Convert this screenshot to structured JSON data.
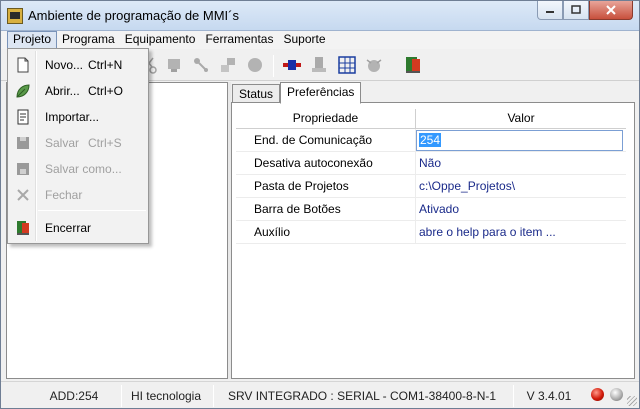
{
  "window": {
    "title": "Ambiente de programação de MMI´s"
  },
  "menubar": {
    "items": [
      "Projeto",
      "Programa",
      "Equipamento",
      "Ferramentas",
      "Suporte"
    ]
  },
  "projeto_menu": {
    "items": [
      {
        "label": "Novo...",
        "shortcut": "Ctrl+N",
        "icon": "new-file-icon",
        "enabled": true
      },
      {
        "label": "Abrir...",
        "shortcut": "Ctrl+O",
        "icon": "open-leaf-icon",
        "enabled": true
      },
      {
        "label": "Importar...",
        "shortcut": "",
        "icon": "import-document-icon",
        "enabled": true
      },
      {
        "label": "Salvar",
        "shortcut": "Ctrl+S",
        "icon": "save-disk-icon",
        "enabled": false
      },
      {
        "label": "Salvar como...",
        "shortcut": "",
        "icon": "save-as-icon",
        "enabled": false
      },
      {
        "label": "Fechar",
        "shortcut": "",
        "icon": "close-x-icon",
        "enabled": false
      },
      {
        "label": "Encerrar",
        "shortcut": "",
        "icon": "exit-door-icon",
        "enabled": true
      }
    ]
  },
  "toolbar": {
    "icons": [
      "cut-icon",
      "component-icon",
      "link-icon",
      "transfer-icon",
      "record-icon",
      "connect-icon",
      "device-icon",
      "matrix-icon",
      "debug-icon",
      "exit-door-icon"
    ]
  },
  "tabs": [
    {
      "label": "Status",
      "active": false
    },
    {
      "label": "Preferências",
      "active": true
    }
  ],
  "grid": {
    "columns": [
      "Propriedade",
      "Valor"
    ],
    "rows": [
      {
        "property": "End. de Comunicação",
        "value": "254",
        "editing": true
      },
      {
        "property": "Desativa autoconexão",
        "value": "Não",
        "editing": false
      },
      {
        "property": "Pasta de Projetos",
        "value": "c:\\Oppe_Projetos\\",
        "editing": false
      },
      {
        "property": "Barra de Botões",
        "value": "Ativado",
        "editing": false
      },
      {
        "property": "Auxílio",
        "value": "abre o help para o item ...",
        "editing": false
      }
    ]
  },
  "statusbar": {
    "address": "ADD:254",
    "company": "HI tecnologia",
    "connection": "SRV INTEGRADO : SERIAL - COM1-38400-8-N-1",
    "version": "V 3.4.01",
    "led_colors": [
      "#d21a0a",
      "#b0b0b0"
    ]
  }
}
